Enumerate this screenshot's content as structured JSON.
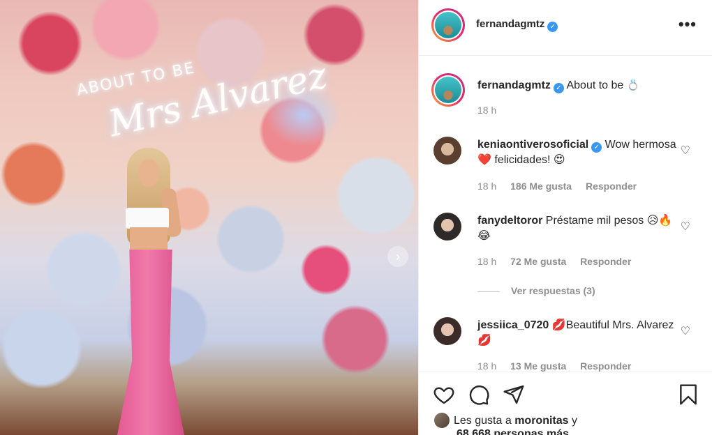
{
  "post": {
    "neon_line1": "ABOUT TO BE",
    "neon_line2": "Mrs Alvarez"
  },
  "header": {
    "username": "fernandagmtz",
    "verified": true,
    "more_icon": "more-horizontal-icon"
  },
  "caption": {
    "username": "fernandagmtz",
    "text": "About to be",
    "emoji": "💍",
    "time": "18 h"
  },
  "comments": [
    {
      "username": "keniaontiverosoficial",
      "verified": true,
      "text": "Wow hermosa ❤️ felicidades! 😍",
      "time": "18 h",
      "likes": "186 Me gusta",
      "reply": "Responder"
    },
    {
      "username": "fanydeltoror",
      "verified": false,
      "text": "Préstame mil pesos 😥🔥😂",
      "time": "18 h",
      "likes": "72 Me gusta",
      "reply": "Responder"
    },
    {
      "username": "jessiica_0720",
      "verified": false,
      "text": "💋Beautiful Mrs. Alvarez💋",
      "time": "18 h",
      "likes": "13 Me gusta",
      "reply": "Responder"
    }
  ],
  "view_replies": "Ver respuestas (3)",
  "actions": {
    "like_icon": "heart-icon",
    "comment_icon": "comment-icon",
    "share_icon": "share-icon",
    "save_icon": "bookmark-icon"
  },
  "likes_summary": {
    "prefix": "Les gusta a",
    "user": "moronitas",
    "connector": "y",
    "count": "68.668 personas más"
  }
}
